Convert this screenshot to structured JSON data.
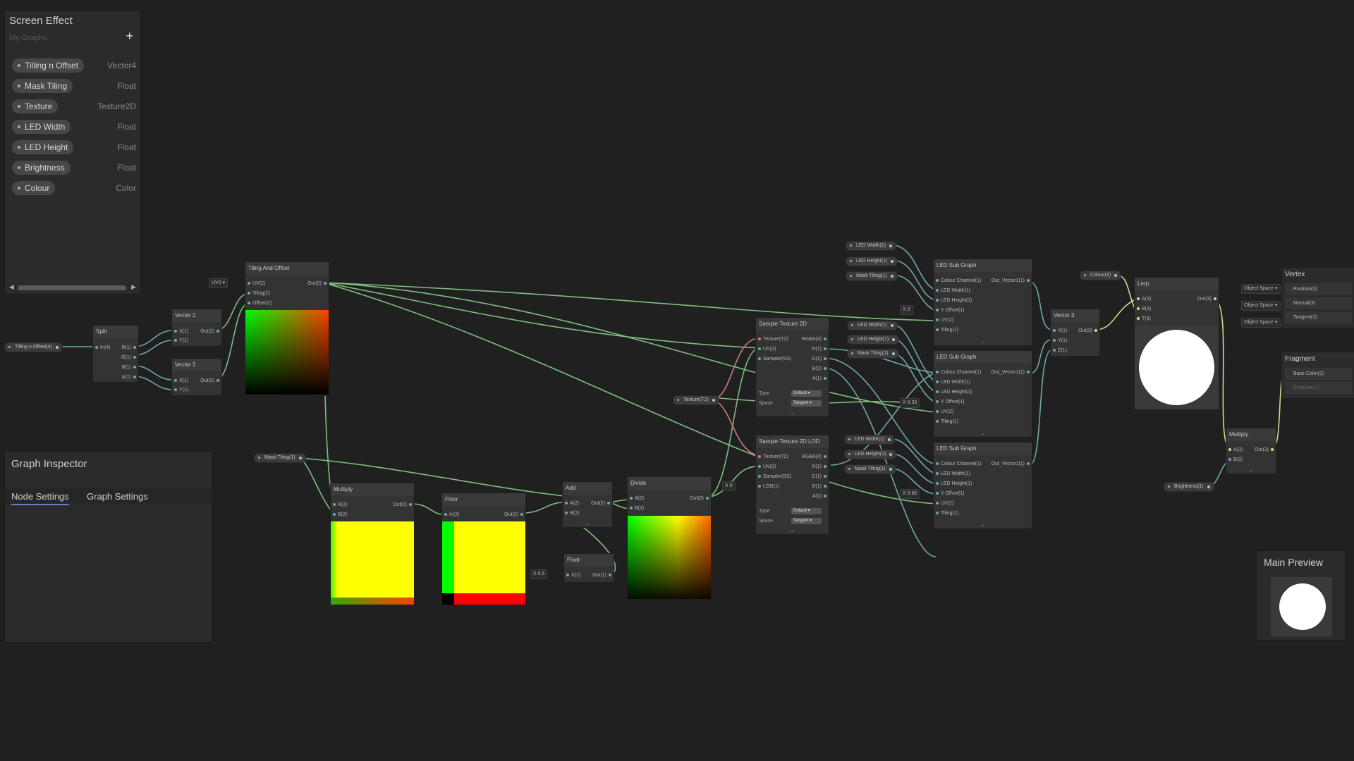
{
  "blackboard": {
    "title": "Screen Effect",
    "subtitle": "My Graphs",
    "add_label": "+",
    "properties": [
      {
        "name": "Tilling n Offset",
        "type": "Vector4"
      },
      {
        "name": "Mask Tiling",
        "type": "Float"
      },
      {
        "name": "Texture",
        "type": "Texture2D"
      },
      {
        "name": "LED Width",
        "type": "Float"
      },
      {
        "name": "LED Height",
        "type": "Float"
      },
      {
        "name": "Brightness",
        "type": "Float"
      },
      {
        "name": "Colour",
        "type": "Color"
      }
    ]
  },
  "inspector": {
    "title": "Graph Inspector",
    "tabs": [
      "Node Settings",
      "Graph Settings"
    ]
  },
  "main_preview": {
    "title": "Main Preview"
  },
  "graph": {
    "prop_nodes": {
      "tilling": "Tilling n Offset(4)",
      "mask_tiling": "Mask Tiling(1)",
      "texture": "Texture(T2)",
      "colour": "Colour(4)",
      "brightness": "Brightness(1)",
      "led_width": "LED Width(1)",
      "led_height": "LED Height(1)",
      "mask_tiling2": "Mask Tiling(1)"
    },
    "split": {
      "title": "Split",
      "in": "In(4)",
      "outs": [
        "R(1)",
        "G(1)",
        "B(1)",
        "A(1)"
      ]
    },
    "vector2": {
      "title": "Vector 2",
      "ins": [
        "X(1)",
        "Y(1)"
      ],
      "out": "Out(2)"
    },
    "tiling_offset": {
      "title": "Tiling And Offset",
      "ins": [
        "UV(2)",
        "Tiling(2)",
        "Offset(2)"
      ],
      "out": "Out(2)",
      "uv_value": "UV0"
    },
    "multiply": {
      "title": "Multiply",
      "ins": [
        "A(2)",
        "B(2)"
      ],
      "out": "Out(2)"
    },
    "floor": {
      "title": "Floor",
      "ins": [
        "In(2)"
      ],
      "out": "Out(2)"
    },
    "add": {
      "title": "Add",
      "ins": [
        "A(2)",
        "B(2)"
      ],
      "out": "Out(2)"
    },
    "float_node": {
      "title": "Float",
      "ins": [
        "X(1)"
      ],
      "out": "Out(1)",
      "value_x": "X",
      "value": "0.5"
    },
    "divide": {
      "title": "Divide",
      "ins": [
        "A(2)",
        "B(2)"
      ],
      "out": "Out(2)"
    },
    "sample2d": {
      "title": "Sample Texture 2D",
      "ins": [
        "Texture(T2)",
        "UV(2)",
        "Sampler(SS)"
      ],
      "outs": [
        "RGBA(4)",
        "R(1)",
        "G(1)",
        "B(1)",
        "A(1)"
      ],
      "type_label": "Type",
      "type_value": "Default",
      "space_label": "Space",
      "space_value": "Tangent"
    },
    "sample2dlod": {
      "title": "Sample Texture 2D LOD",
      "ins": [
        "Texture(T2)",
        "UV(2)",
        "Sampler(SS)",
        "LOD(1)"
      ],
      "outs": [
        "RGBA(4)",
        "R(1)",
        "G(1)",
        "B(1)",
        "A(1)"
      ],
      "type_label": "Type",
      "type_value": "Default",
      "space_label": "Space",
      "space_value": "Tangent",
      "lod_x": "X",
      "lod_value": "0"
    },
    "led_sub": {
      "title": "LED Sub Graph",
      "ins": [
        "Colour Channel(1)",
        "LED Width(1)",
        "LED Height(1)",
        "Y Offset(1)",
        "UV(2)",
        "Tiling(1)"
      ],
      "out": "Out_Vector1(1)"
    },
    "y_offsets": [
      {
        "x": "X",
        "v": "0"
      },
      {
        "x": "X",
        "v": "0.33"
      },
      {
        "x": "X",
        "v": "0.66"
      }
    ],
    "vector3": {
      "title": "Vector 3",
      "ins": [
        "X(1)",
        "Y(1)",
        "Z(1)"
      ],
      "out": "Out(3)"
    },
    "lerp": {
      "title": "Lerp",
      "ins": [
        "A(3)",
        "B(3)",
        "T(3)"
      ],
      "out": "Out(3)"
    },
    "multiply2": {
      "title": "Multiply",
      "ins": [
        "A(3)",
        "B(3)"
      ],
      "out": "Out(3)"
    },
    "vertex": {
      "title": "Vertex",
      "slots": [
        "Position(3)",
        "Normal(3)",
        "Tangent(3)"
      ],
      "space": "Object Space"
    },
    "fragment": {
      "title": "Fragment",
      "slots": [
        "Base Color(3)",
        "Emission(3)"
      ]
    }
  },
  "colors": {
    "background": "#202020",
    "wire_green": "#7fbf7f",
    "wire_teal": "#5fa3a3",
    "wire_pink": "#c88080",
    "wire_yellow": "#d8d890"
  }
}
